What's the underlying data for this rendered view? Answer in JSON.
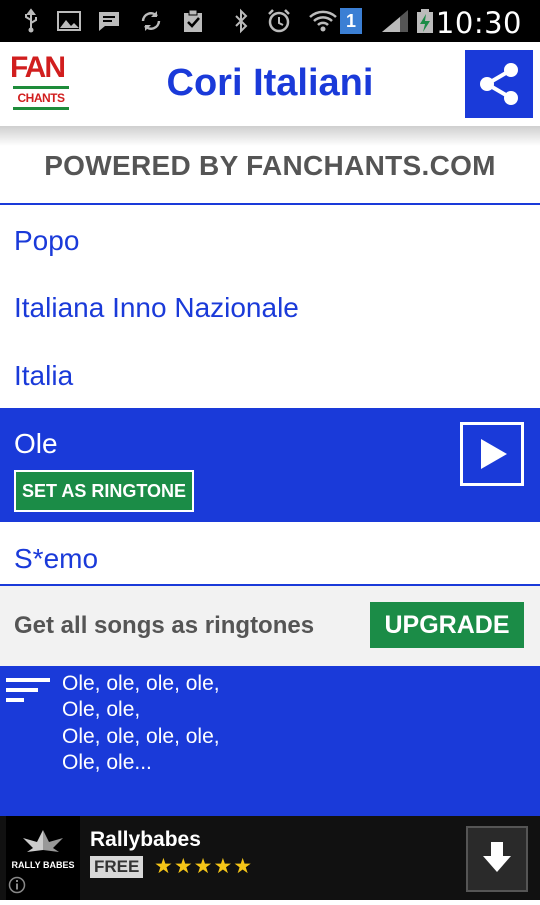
{
  "status_bar": {
    "time": "10:30",
    "sim_badge": "1",
    "icons": [
      "usb-icon",
      "image-icon",
      "chat-icon",
      "sync-icon",
      "clipboard-check-icon",
      "bluetooth-icon",
      "alarm-icon",
      "wifi-icon",
      "signal-icon",
      "battery-charging-icon"
    ]
  },
  "app_bar": {
    "logo_top": "FAN",
    "logo_bottom": "CHANTS",
    "title": "Cori Italiani",
    "share_icon": "share-icon"
  },
  "powered_by": "POWERED BY FANCHANTS.COM",
  "songs": [
    {
      "title": "Popo"
    },
    {
      "title": "Italiana Inno Nazionale"
    },
    {
      "title": "Italia"
    },
    {
      "title": "Ole",
      "selected": true,
      "action_label": "SET AS RINGTONE",
      "play_icon": "play-icon"
    },
    {
      "title": "S*emo"
    }
  ],
  "upsell": {
    "text": "Get all songs as ringtones",
    "button_label": "UPGRADE"
  },
  "lyrics": {
    "icon": "lyrics-lines-icon",
    "lines": [
      "Ole, ole, ole, ole,",
      "Ole, ole,",
      "Ole, ole, ole, ole,",
      "Ole, ole..."
    ]
  },
  "ad": {
    "logo_text": "RALLY BABES",
    "app_name": "Rallybabes",
    "price": "FREE",
    "stars": "★★★★★",
    "download_icon": "download-icon",
    "info_icon": "info-icon"
  },
  "colors": {
    "accent_blue": "#1a3ad9",
    "green_button": "#1b8c47",
    "brand_red": "#d11e1e"
  }
}
